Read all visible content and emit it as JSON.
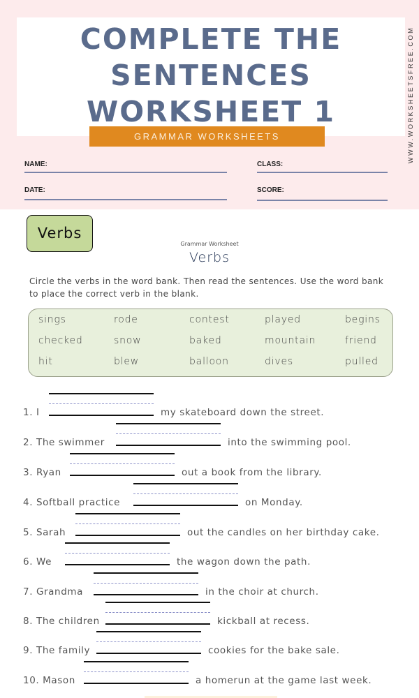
{
  "header": {
    "title_lines": [
      "COMPLETE THE",
      "SENTENCES",
      "WORKSHEET 1"
    ],
    "banner": "GRAMMAR WORKSHEETS",
    "site_url": "WWW.WORKSHEETSFREE.COM",
    "fields": {
      "name": "NAME:",
      "class": "CLASS:",
      "date": "DATE:",
      "score": "SCORE:"
    },
    "colors": {
      "background": "#fdebec",
      "title": "#5a6b8c",
      "banner": "#e0891f"
    }
  },
  "badge": {
    "label": "Verbs",
    "color": "#c5d99a"
  },
  "worksheet": {
    "subtitle": "Grammar Worksheet",
    "title": "Verbs",
    "instructions": "Circle the verbs in the word bank.  Then read the sentences.  Use the word bank to place the correct verb in the blank."
  },
  "word_bank": {
    "rows": [
      [
        "sings",
        "rode",
        "contest",
        "played",
        "begins"
      ],
      [
        "checked",
        "snow",
        "baked",
        "mountain",
        "friend"
      ],
      [
        "hit",
        "blew",
        "balloon",
        "dives",
        "pulled"
      ]
    ]
  },
  "sentences": [
    {
      "prefix": "1.  I",
      "suffix": "my skateboard down the street."
    },
    {
      "prefix": "2.  The swimmer",
      "suffix": "into the swimming pool."
    },
    {
      "prefix": "3.  Ryan",
      "suffix": "out a book from the library."
    },
    {
      "prefix": "4.  Softball practice",
      "suffix": "on Monday."
    },
    {
      "prefix": "5.  Sarah",
      "suffix": "out the candles on her birthday cake."
    },
    {
      "prefix": "6.  We",
      "suffix": "the wagon down the path."
    },
    {
      "prefix": "7.  Grandma",
      "suffix": "in the choir at church."
    },
    {
      "prefix": "8.  The children",
      "suffix": "kickball at recess."
    },
    {
      "prefix": "9. The family",
      "suffix": "cookies for the bake sale."
    },
    {
      "prefix": "10. Mason",
      "suffix": "a homerun at the game last week."
    }
  ]
}
